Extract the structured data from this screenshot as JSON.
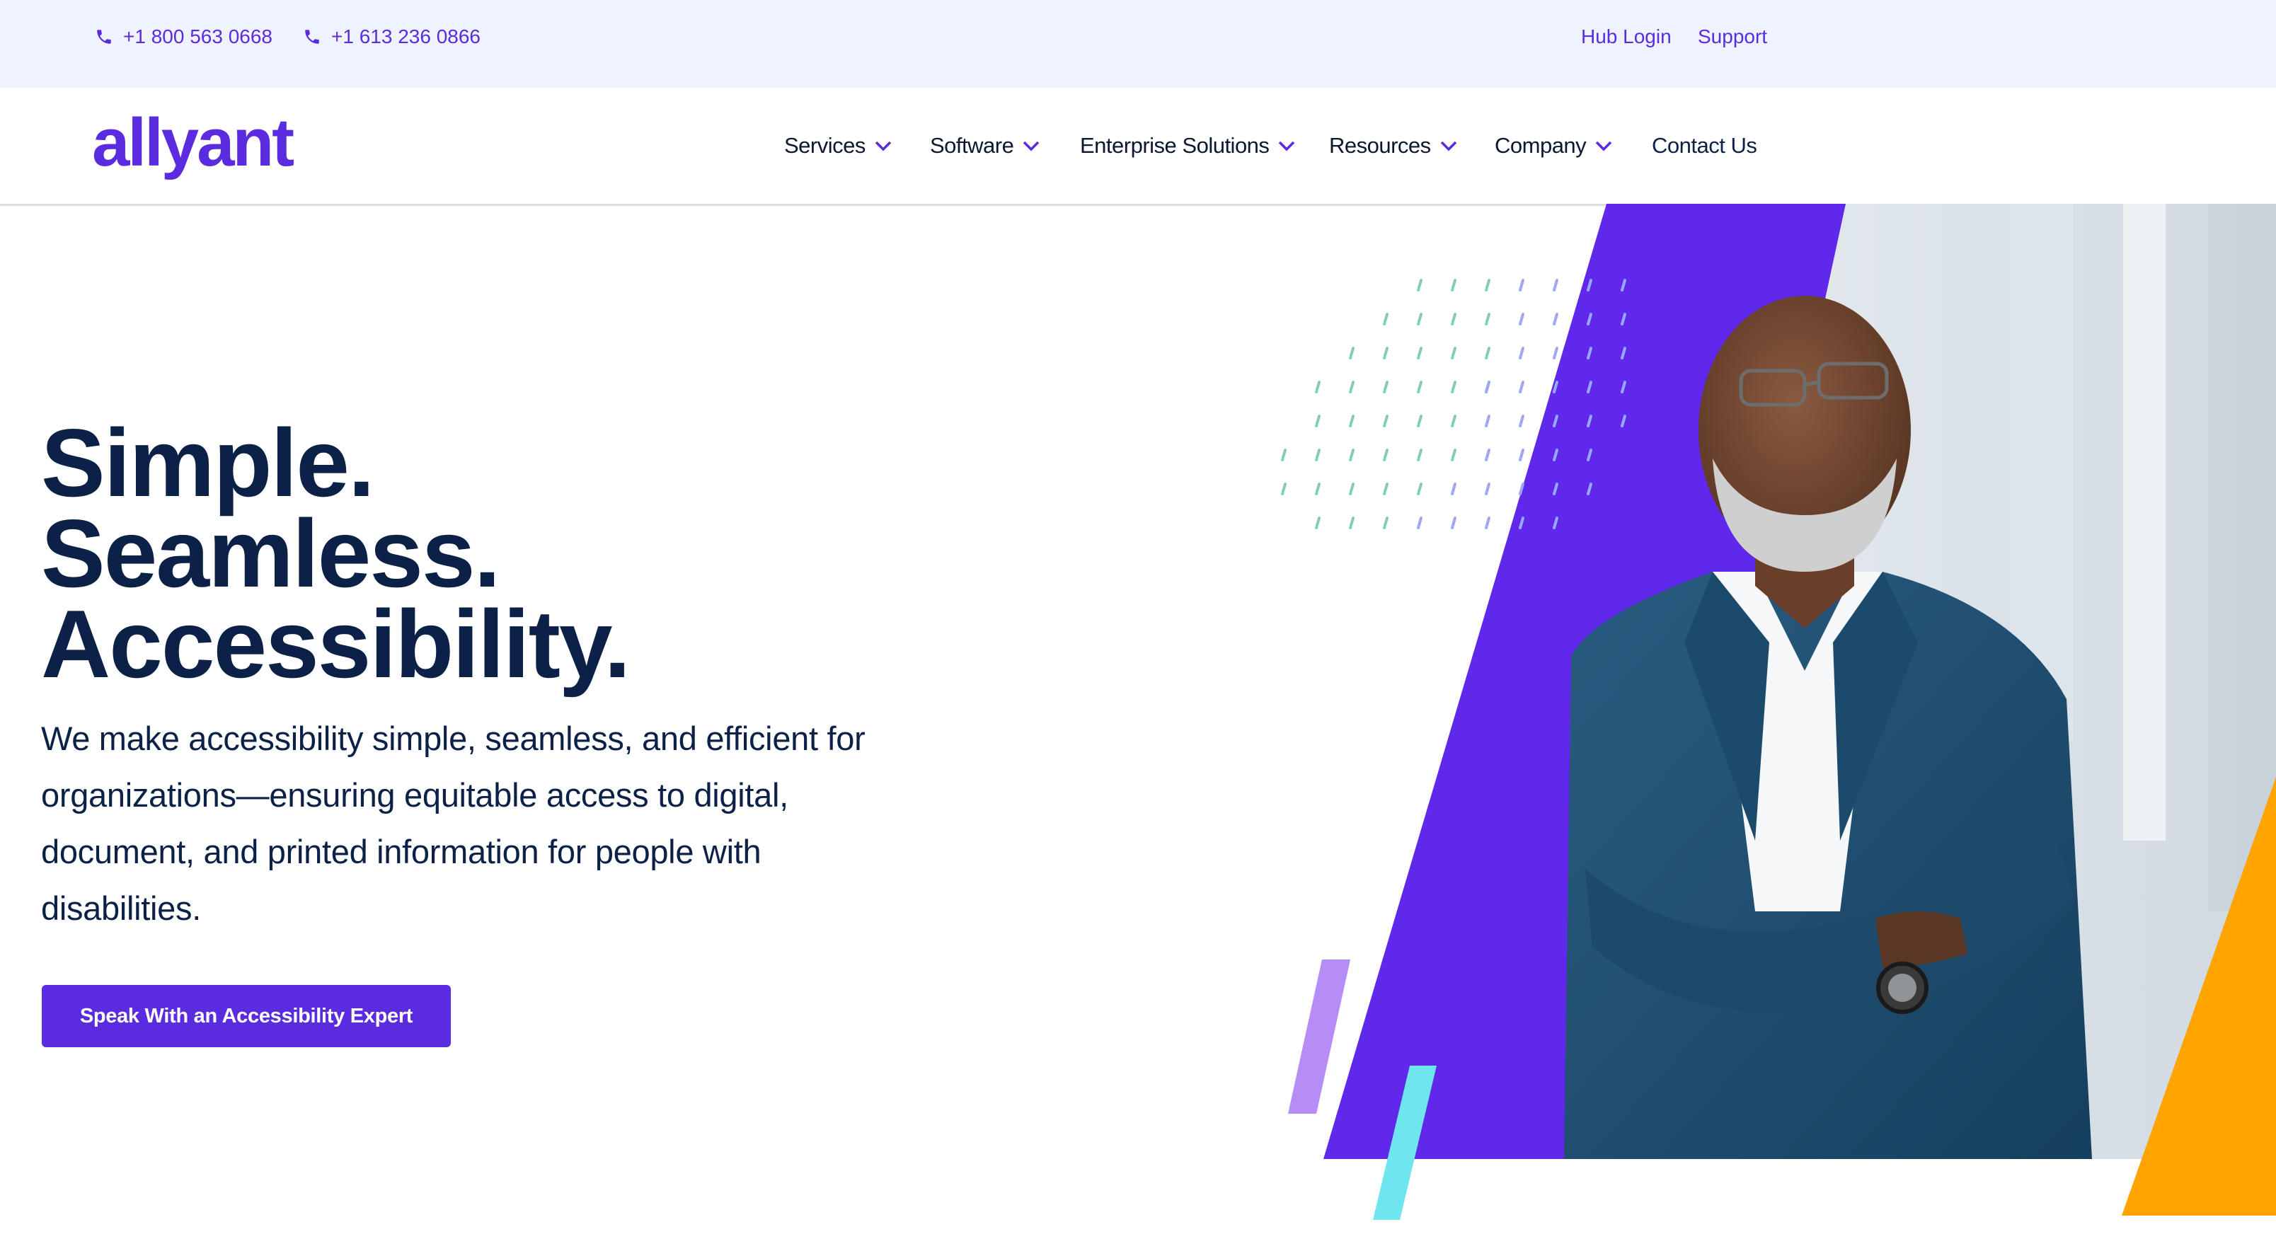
{
  "topbar": {
    "phones": [
      {
        "number": "+1 800 563 0668",
        "icon": "phone-icon"
      },
      {
        "number": "+1 613 236 0866",
        "icon": "phone-icon"
      }
    ],
    "links": [
      {
        "label": "Hub Login"
      },
      {
        "label": "Support"
      }
    ]
  },
  "header": {
    "logo_text": "allyant",
    "nav": [
      {
        "label": "Services",
        "icon": "chevron-down-icon"
      },
      {
        "label": "Software",
        "icon": "chevron-down-icon"
      },
      {
        "label": "Enterprise Solutions",
        "icon": "chevron-down-icon"
      },
      {
        "label": "Resources",
        "icon": "chevron-down-icon"
      },
      {
        "label": "Company",
        "icon": "chevron-down-icon"
      },
      {
        "label": "Contact Us"
      }
    ]
  },
  "hero": {
    "headline": [
      "Simple.",
      "Seamless.",
      "Accessibility."
    ],
    "description": "We make accessibility simple, seamless, and efficient for organizations—ensuring equitable access to digital, document, and printed information for people with disabilities.",
    "cta_label": "Speak With an Accessibility Expert"
  },
  "colors": {
    "brand_purple": "#5b2be0",
    "navy_text": "#0c2147",
    "topbar_bg": "#eef3ff",
    "accent_orange": "#ffa400",
    "accent_cyan": "#6fe6ef",
    "accent_lavender": "#b68cf7"
  }
}
